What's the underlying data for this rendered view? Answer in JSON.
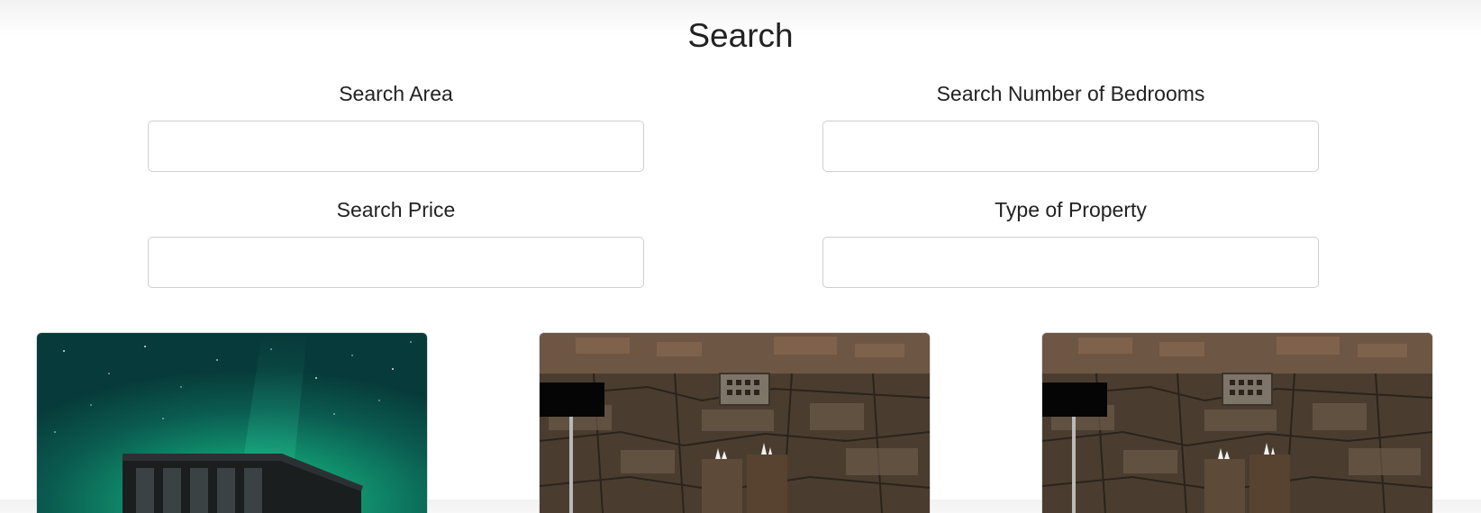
{
  "page": {
    "title": "Search"
  },
  "search": {
    "area": {
      "label": "Search Area",
      "value": "",
      "placeholder": ""
    },
    "bedrooms": {
      "label": "Search Number of Bedrooms",
      "value": "",
      "placeholder": ""
    },
    "price": {
      "label": "Search Price",
      "value": "",
      "placeholder": ""
    },
    "property_type": {
      "label": "Type of Property",
      "value": "",
      "placeholder": ""
    }
  },
  "listings": [
    {
      "image": "aurora-night-house"
    },
    {
      "image": "stone-wall-fireplace-interior"
    },
    {
      "image": "stone-wall-fireplace-interior"
    }
  ],
  "colors": {
    "text": "#222222",
    "input_border": "#cfcfcf",
    "background": "#ffffff"
  }
}
